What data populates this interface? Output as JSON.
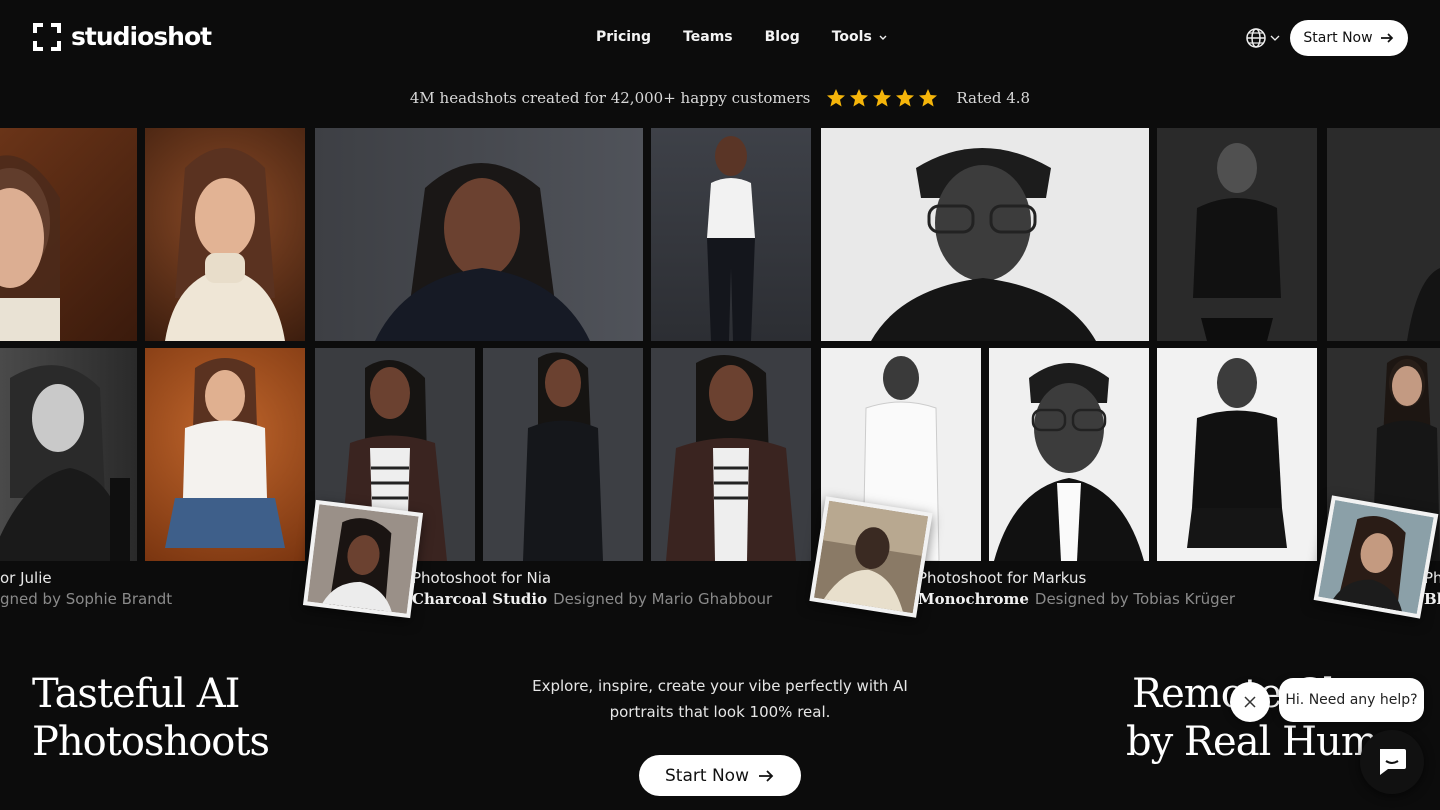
{
  "nav": {
    "brand": "studioshot",
    "links": [
      "Pricing",
      "Teams",
      "Blog",
      "Tools"
    ],
    "start_label": "Start Now"
  },
  "tagline": {
    "text": "4M headshots created for 42,000+ happy customers",
    "rating_label": "Rated 4.8",
    "stars": 5,
    "star_color": "#f5b50a"
  },
  "showcases": [
    {
      "title": "or Julie",
      "style": "",
      "designer": "gned by Sophie Brandt"
    },
    {
      "title": "Photoshoot for Nia",
      "style": "Charcoal Studio",
      "designer": "Designed by Mario Ghabbour"
    },
    {
      "title": "Photoshoot for Markus",
      "style": "Monochrome",
      "designer": "Designed by Tobias Krüger"
    },
    {
      "title": "Ph",
      "style": "Bl",
      "designer": ""
    }
  ],
  "hero": {
    "left_title_1": "Tasteful AI",
    "left_title_2": "Photoshoots",
    "subtitle_1": "Explore, inspire, create your vibe perfectly with AI",
    "subtitle_2": "portraits that look 100% real.",
    "cta_label": "Start Now",
    "right_title_1": "Remote Cl",
    "right_title_2": "by Real Huma"
  },
  "chat": {
    "bubble": "Hi. Need any help?"
  }
}
